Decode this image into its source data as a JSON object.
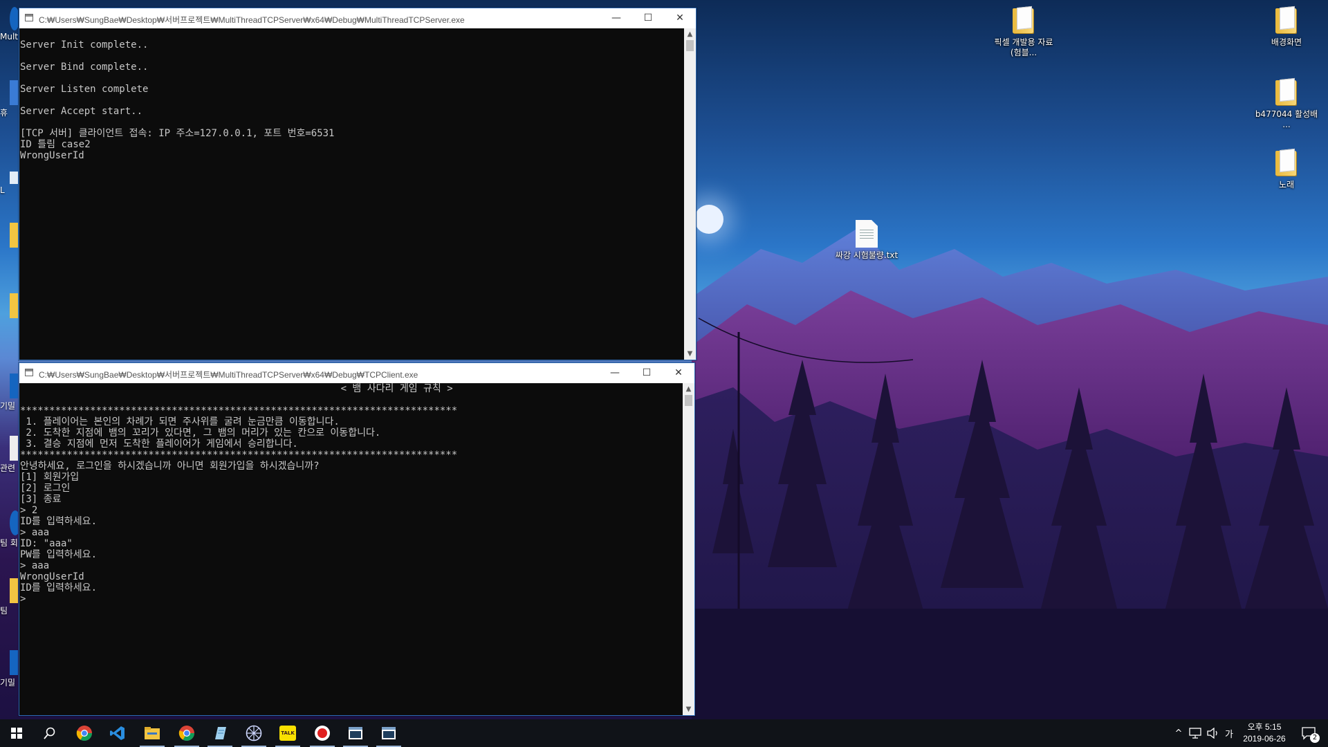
{
  "desktop": {
    "icons_right": [
      {
        "label": "픽셀 개발용 자료(험블...",
        "type": "folder"
      },
      {
        "label": "배경화면",
        "type": "folder"
      },
      {
        "label": "b477044 활성배 ...",
        "type": "folder"
      },
      {
        "label": "노래",
        "type": "folder"
      },
      {
        "label": "싸강 시험불량.txt",
        "type": "text-file"
      }
    ],
    "left_strip_labels": [
      "Mult",
      "휴",
      "L",
      "기밀",
      "관련",
      "팀 회",
      "팀",
      "기밀"
    ]
  },
  "server_window": {
    "title": "C:₩Users₩SungBae₩Desktop₩서버프로젝트₩MultiThreadTCPServer₩x64₩Debug₩MultiThreadTCPServer.exe",
    "controls": {
      "minimize": "—",
      "maximize": "☐",
      "close": "✕"
    },
    "lines": [
      "Server Init complete..",
      "",
      "Server Bind complete..",
      "",
      "Server Listen complete",
      "",
      "Server Accept start..",
      "",
      "[TCP 서버] 클라이언트 접속: IP 주소=127.0.0.1, 포트 번호=6531",
      "ID 틀림 case2",
      "WrongUserId"
    ]
  },
  "client_window": {
    "title": "C:₩Users₩SungBae₩Desktop₩서버프로젝트₩MultiThreadTCPServer₩x64₩Debug₩TCPClient.exe",
    "controls": {
      "minimize": "—",
      "maximize": "☐",
      "close": "✕"
    },
    "lines": [
      "                                                       < 뱀 사다리 게임 규칙 >",
      "",
      "***************************************************************************",
      " 1. 플레이어는 본인의 차례가 되면 주사위를 굴려 눈금만큼 이동합니다.",
      " 2. 도착한 지점에 뱀의 꼬리가 있다면, 그 뱀의 머리가 있는 칸으로 이동합니다.",
      " 3. 결승 지점에 먼저 도착한 플레이어가 게임에서 승리합니다.",
      "***************************************************************************",
      "안녕하세요, 로그인을 하시겠습니까 아니면 회원가입을 하시겠습니까?",
      "[1] 회원가입",
      "[2] 로그인",
      "[3] 종료",
      "> 2",
      "ID를 입력하세요.",
      "> aaa",
      "ID: \"aaa\"",
      "PW를 입력하세요.",
      "> aaa",
      "WrongUserId",
      "ID를 입력하세요.",
      ">"
    ]
  },
  "taskbar": {
    "apps": [
      "start-icon",
      "search-icon",
      "chrome-icon",
      "vscode-icon",
      "file-explorer-icon",
      "chrome-icon",
      "notepad-icon",
      "network-app-icon",
      "kakaotalk-icon",
      "record-icon",
      "console-icon",
      "console-icon"
    ],
    "kakao_label": "TALK",
    "tray": {
      "chevron": "^",
      "ime": "가"
    },
    "clock": {
      "time": "오후 5:15",
      "date": "2019-06-26"
    },
    "notification_count": "2"
  }
}
